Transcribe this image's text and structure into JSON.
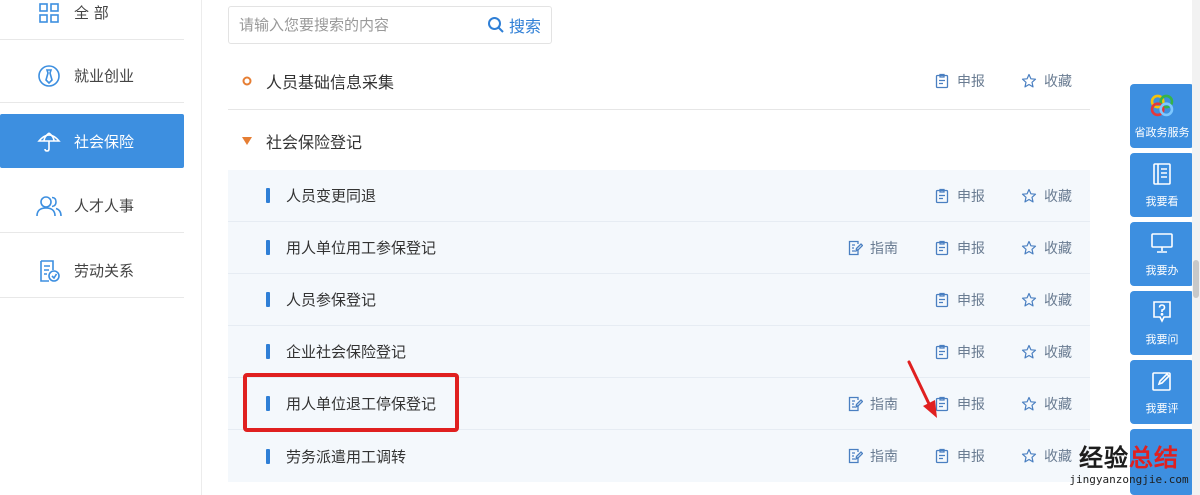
{
  "sidebar": {
    "items": [
      {
        "label": "全 部",
        "icon": "grid-icon",
        "active": false
      },
      {
        "label": "就业创业",
        "icon": "tie-icon",
        "active": false
      },
      {
        "label": "社会保险",
        "icon": "umbrella-icon",
        "active": true
      },
      {
        "label": "人才人事",
        "icon": "people-icon",
        "active": false
      },
      {
        "label": "劳动关系",
        "icon": "contract-icon",
        "active": false
      }
    ]
  },
  "search": {
    "placeholder": "请输入您要搜索的内容",
    "value": "",
    "button_label": "搜索"
  },
  "categories": [
    {
      "title": "人员基础信息采集",
      "marker": "circle",
      "declare_label": "申报",
      "favorite_label": "收藏"
    },
    {
      "title": "社会保险登记",
      "marker": "triangle-down"
    }
  ],
  "sub_items": [
    {
      "title": "人员变更同退",
      "guide_label": "",
      "declare_label": "申报",
      "favorite_label": "收藏"
    },
    {
      "title": "用人单位用工参保登记",
      "guide_label": "指南",
      "declare_label": "申报",
      "favorite_label": "收藏"
    },
    {
      "title": "人员参保登记",
      "guide_label": "",
      "declare_label": "申报",
      "favorite_label": "收藏"
    },
    {
      "title": "企业社会保险登记",
      "guide_label": "",
      "declare_label": "申报",
      "favorite_label": "收藏"
    },
    {
      "title": "用人单位退工停保登记",
      "guide_label": "指南",
      "declare_label": "申报",
      "favorite_label": "收藏"
    },
    {
      "title": "劳务派遣用工调转",
      "guide_label": "指南",
      "declare_label": "申报",
      "favorite_label": "收藏"
    }
  ],
  "right_panel": [
    {
      "label": "省政务服务",
      "icon": "logo-icon"
    },
    {
      "label": "我要看",
      "icon": "book-icon"
    },
    {
      "label": "我要办",
      "icon": "monitor-icon"
    },
    {
      "label": "我要问",
      "icon": "question-icon"
    },
    {
      "label": "我要评",
      "icon": "edit-icon"
    }
  ],
  "watermark": {
    "main_a": "经验",
    "main_b": "总结",
    "sub": "jingyanzongjie.com"
  },
  "colors": {
    "accent": "#3d8fe0",
    "highlight": "#e02020",
    "link": "#2f7fd6"
  }
}
